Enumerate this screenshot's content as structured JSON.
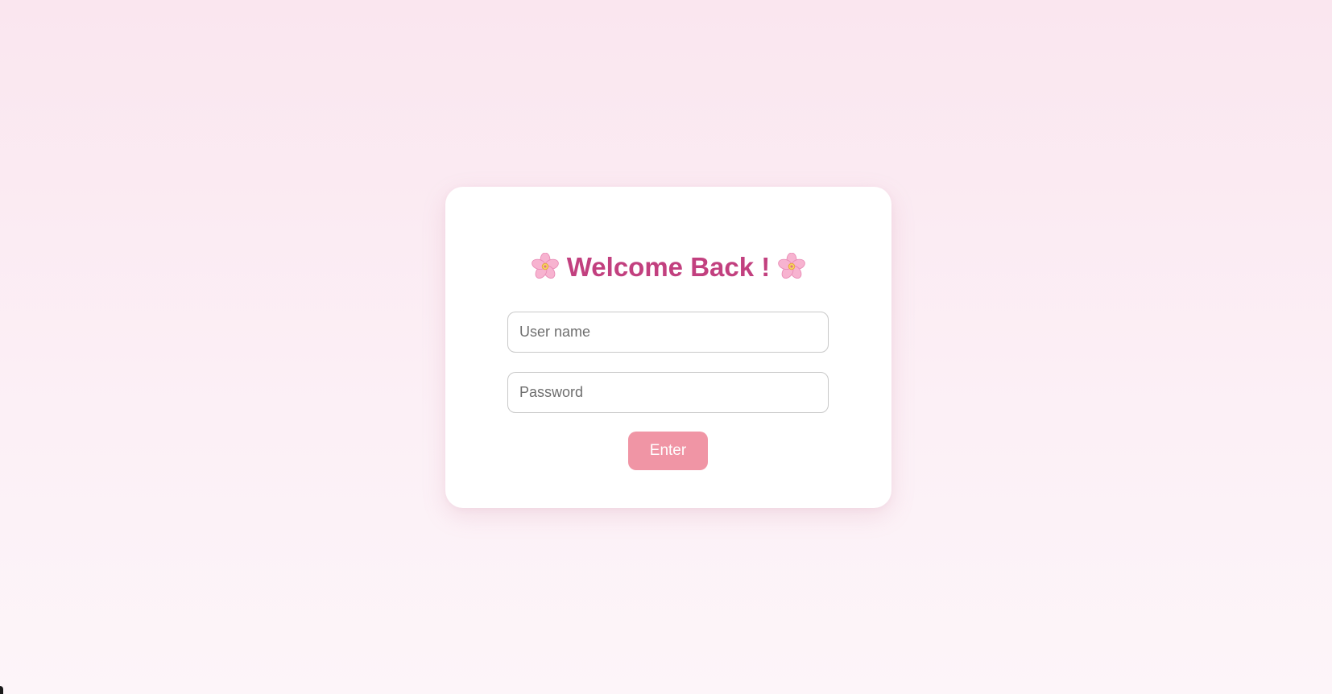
{
  "login": {
    "title": "Welcome Back !",
    "title_icon": "cherry-blossom-icon",
    "username_placeholder": "User name",
    "username_value": "",
    "password_placeholder": "Password",
    "password_value": "",
    "submit_label": "Enter"
  },
  "colors": {
    "background_top": "#fae6ef",
    "background_bottom": "#fdf5f9",
    "card": "#ffffff",
    "title": "#c2407f",
    "button": "#f095a5",
    "button_text": "#ffffff",
    "input_border": "#c9c9c9"
  }
}
